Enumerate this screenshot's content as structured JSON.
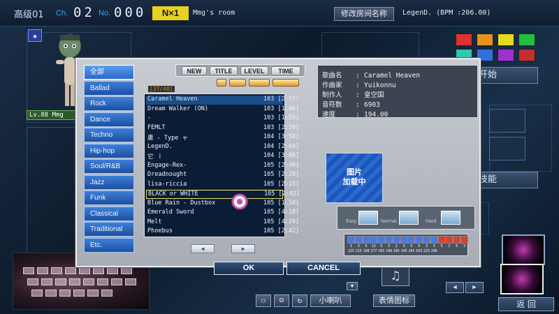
{
  "header": {
    "room_level": "高级01",
    "ch_label": "Ch.",
    "ch_value": "02",
    "no_label": "No.",
    "no_value": "000",
    "mode_badge": "N×1",
    "room_name": "Mmg's room",
    "rename_button": "修改房间名称",
    "current_song": "LegenD. (BPM :206.00)"
  },
  "player": {
    "star_badge": "★",
    "level_tag": "Lv.88 Mmg"
  },
  "dialog": {
    "categories": [
      {
        "label": "全部",
        "active": true
      },
      {
        "label": "Ballad",
        "active": false
      },
      {
        "label": "Rock",
        "active": false
      },
      {
        "label": "Dance",
        "active": false
      },
      {
        "label": "Techno",
        "active": false
      },
      {
        "label": "Hip-hop",
        "active": false
      },
      {
        "label": "Soul/R&B",
        "active": false
      },
      {
        "label": "Jazz",
        "active": false
      },
      {
        "label": "Funk",
        "active": false
      },
      {
        "label": "Classical",
        "active": false
      },
      {
        "label": "Traditional",
        "active": false
      },
      {
        "label": "Etc.",
        "active": false
      }
    ],
    "sort_tabs": [
      "NEW",
      "TITLE",
      "LEVEL",
      "TIME"
    ],
    "page_count": "[37/40]",
    "songs": [
      {
        "title": "Caramel Heaven",
        "level_time": "103 [2:58]",
        "selected": true,
        "boxed": false
      },
      {
        "title": "Dream Walker (ON)",
        "level_time": "103 [1:46]",
        "selected": false,
        "boxed": false
      },
      {
        "title": "   -",
        "level_time": "103 [1:59]",
        "selected": false,
        "boxed": false
      },
      {
        "title": "FEMLT",
        "level_time": "103 [2:50]",
        "selected": false,
        "boxed": false
      },
      {
        "title": "         庸  - Type ャ",
        "level_time": "104 [3:58]",
        "selected": false,
        "boxed": false
      },
      {
        "title": "LegenD.",
        "level_time": "104 [2:04]",
        "selected": false,
        "boxed": false
      },
      {
        "title": "         它      ｉ",
        "level_time": "104 [3:06]",
        "selected": false,
        "boxed": false
      },
      {
        "title": "Engage-Rex-",
        "level_time": "105 [2:40]",
        "selected": false,
        "boxed": false
      },
      {
        "title": "Dreadnought",
        "level_time": "105 [2:20]",
        "selected": false,
        "boxed": false
      },
      {
        "title": "lisa-riccia",
        "level_time": "105 [2:15]",
        "selected": false,
        "boxed": false
      },
      {
        "title": "BLACK or WHITE",
        "level_time": "105 [2:02]",
        "selected": false,
        "boxed": true
      },
      {
        "title": "Blue Rain - Dustbox",
        "level_time": "105 [1:58]",
        "selected": false,
        "boxed": false
      },
      {
        "title": "Emerald Sword",
        "level_time": "105 [4:18]",
        "selected": false,
        "boxed": false
      },
      {
        "title": "Melt",
        "level_time": "105 [4:20]",
        "selected": false,
        "boxed": false
      },
      {
        "title": "Phoebus",
        "level_time": "105 [2:42]",
        "selected": false,
        "boxed": false
      }
    ],
    "pager_prev": "◀",
    "pager_next": "▶",
    "info": {
      "song_key": "歌曲名",
      "song_value": "Caramel Heaven",
      "composer_key": "作曲家",
      "composer_value": "Yuikonnu",
      "producer_key": "制作人",
      "producer_value": "皇空国",
      "notes_key": "音符数",
      "notes_value": "6903",
      "speed_key": "速度",
      "speed_value": "194.00",
      "sep": ":"
    },
    "cover_text_1": "图片",
    "cover_text_2": "加载中",
    "modes": {
      "easy": "Easy",
      "normal": "Normal",
      "hard": "Hard"
    },
    "level_strip": [
      {
        "color": "#4a7ae0",
        "stars": "1",
        "bpm": "215"
      },
      {
        "color": "#4a7ae0",
        "stars": "3",
        "bpm": "215"
      },
      {
        "color": "#4a7ae0",
        "stars": "5",
        "bpm": "190"
      },
      {
        "color": "#4a7ae0",
        "stars": "12",
        "bpm": "177"
      },
      {
        "color": "#4a7ae0",
        "stars": "3",
        "bpm": "185"
      },
      {
        "color": "#4a7ae0",
        "stars": "3",
        "bpm": "198"
      },
      {
        "color": "#4a7ae0",
        "stars": "2",
        "bpm": "165"
      },
      {
        "color": "#4a7ae0",
        "stars": "3",
        "bpm": "145"
      },
      {
        "color": "#4a7ae0",
        "stars": "5",
        "bpm": "165"
      },
      {
        "color": "#4a7ae0",
        "stars": "4",
        "bpm": "103"
      },
      {
        "color": "#4a7ae0",
        "stars": "3",
        "bpm": "225"
      },
      {
        "color": "#4a7ae0",
        "stars": "3",
        "bpm": "206"
      },
      {
        "color": "#d94030",
        "stars": "5",
        "bpm": ""
      },
      {
        "color": "#d94030",
        "stars": "2",
        "bpm": ""
      },
      {
        "color": "#d94030",
        "stars": "6",
        "bpm": ""
      },
      {
        "color": "#d94030",
        "stars": "3",
        "bpm": ""
      }
    ],
    "ok_label": "OK",
    "cancel_label": "CANCEL"
  },
  "right": {
    "start_label": "开始",
    "skill_label": "技能",
    "back_label": "返 回",
    "swatch_colors": [
      "#e03030",
      "#e89020",
      "#e8d820",
      "#20c040",
      "#30c8b0",
      "#3070e0",
      "#a030d0",
      "#c03030"
    ]
  },
  "toolbar": {
    "speaker_label": "小喇叭",
    "emote_label": "表情图标"
  }
}
